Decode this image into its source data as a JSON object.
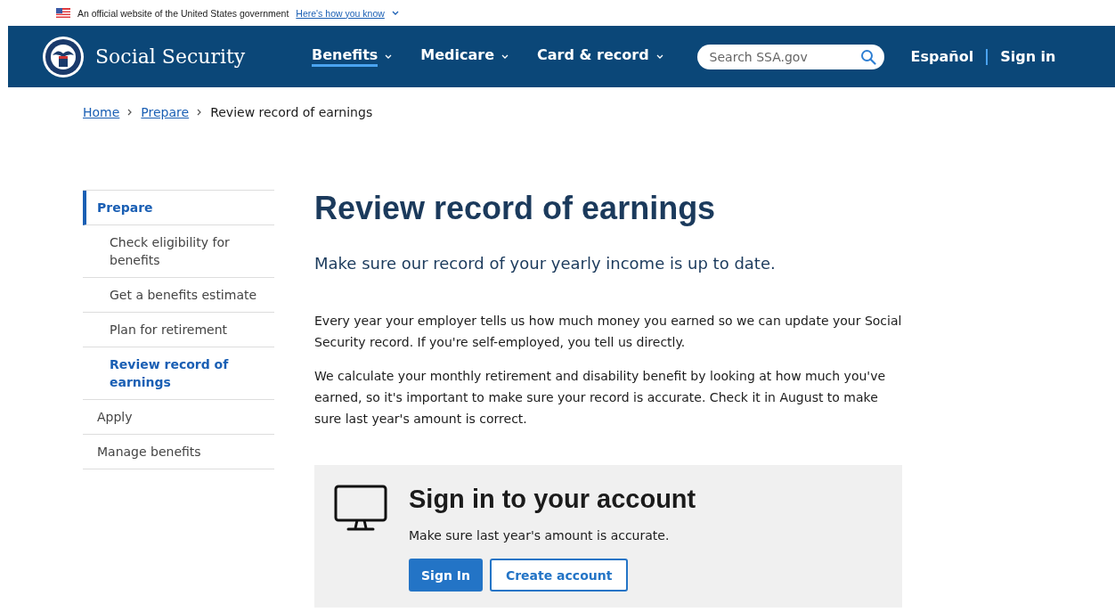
{
  "gov_banner": {
    "text": "An official website of the United States government",
    "link": "Here's how you know"
  },
  "header": {
    "site_name": "Social Security",
    "nav": [
      {
        "label": "Benefits",
        "selected": true
      },
      {
        "label": "Medicare",
        "selected": false
      },
      {
        "label": "Card & record",
        "selected": false
      }
    ],
    "search": {
      "placeholder": "Search SSA.gov"
    },
    "links": [
      "Español",
      "Sign in"
    ]
  },
  "breadcrumb": [
    {
      "label": "Home",
      "link": true
    },
    {
      "label": "Prepare",
      "link": true
    },
    {
      "label": "Review record of earnings",
      "link": false
    }
  ],
  "sidebar": {
    "items": [
      {
        "label": "Prepare",
        "selected": true,
        "children": [
          {
            "label": "Check eligibility for benefits",
            "selected": false
          },
          {
            "label": "Get a benefits estimate",
            "selected": false
          },
          {
            "label": "Plan for retirement",
            "selected": false
          },
          {
            "label": "Review record of earnings",
            "selected": true
          }
        ]
      },
      {
        "label": "Apply",
        "selected": false
      },
      {
        "label": "Manage benefits",
        "selected": false
      }
    ]
  },
  "main": {
    "title": "Review record of earnings",
    "lead": "Make sure our record of your yearly income is up to date.",
    "paragraphs": [
      "Every year your employer tells us how much money you earned so we can update your Social Security record. If you're self-employed, you tell us directly.",
      "We calculate your monthly retirement and disability benefit by looking at how much you've earned, so it's important to make sure your record is accurate. Check it in August to make sure last year's amount is correct."
    ],
    "card": {
      "title": "Sign in to your account",
      "text": "Make sure last year's amount is accurate.",
      "buttons": [
        {
          "label": "Sign In",
          "kind": "primary"
        },
        {
          "label": "Create account",
          "kind": "outline"
        }
      ]
    }
  }
}
